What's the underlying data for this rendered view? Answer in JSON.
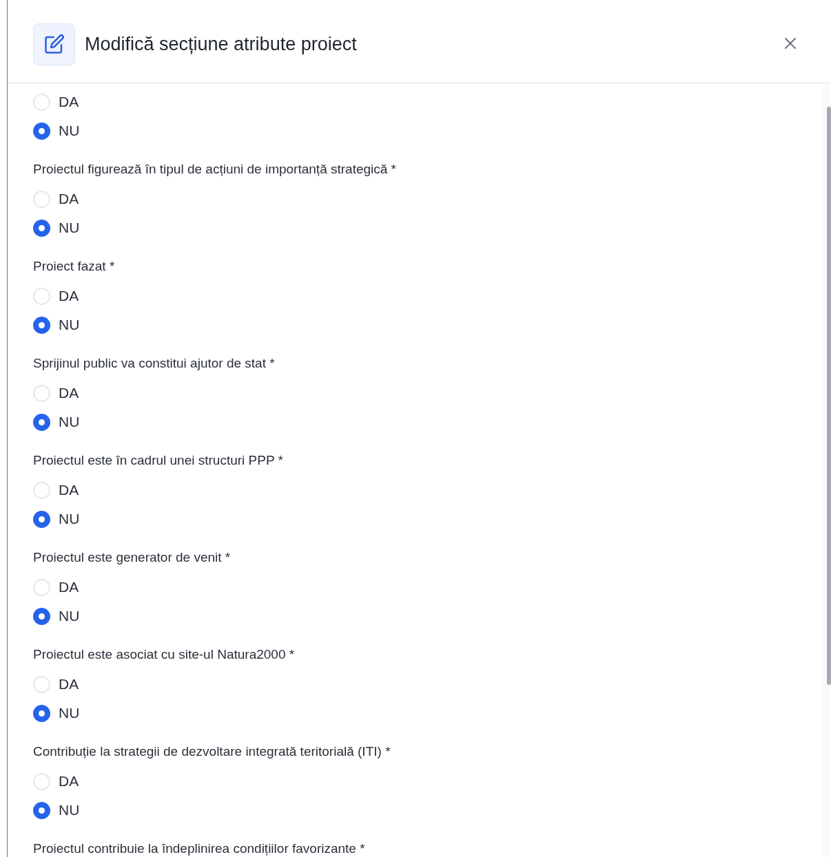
{
  "dialog": {
    "title": "Modifică secțiune atribute proiect"
  },
  "questions": [
    {
      "options": [
        {
          "label": "DA",
          "selected": false
        },
        {
          "label": "NU",
          "selected": true
        }
      ]
    },
    {
      "label": "Proiectul figurează în tipul de acțiuni de importanță strategică *",
      "options": [
        {
          "label": "DA",
          "selected": false
        },
        {
          "label": "NU",
          "selected": true
        }
      ]
    },
    {
      "label": "Proiect fazat *",
      "options": [
        {
          "label": "DA",
          "selected": false
        },
        {
          "label": "NU",
          "selected": true
        }
      ]
    },
    {
      "label": "Sprijinul public va constitui ajutor de stat *",
      "options": [
        {
          "label": "DA",
          "selected": false
        },
        {
          "label": "NU",
          "selected": true
        }
      ]
    },
    {
      "label": "Proiectul este în cadrul unei structuri PPP *",
      "options": [
        {
          "label": "DA",
          "selected": false
        },
        {
          "label": "NU",
          "selected": true
        }
      ]
    },
    {
      "label": "Proiectul este generator de venit *",
      "options": [
        {
          "label": "DA",
          "selected": false
        },
        {
          "label": "NU",
          "selected": true
        }
      ]
    },
    {
      "label": "Proiectul este asociat cu site-ul Natura2000 *",
      "options": [
        {
          "label": "DA",
          "selected": false
        },
        {
          "label": "NU",
          "selected": true
        }
      ]
    },
    {
      "label": "Contribuție la strategii de dezvoltare integrată teritorială (ITI) *",
      "options": [
        {
          "label": "DA",
          "selected": false
        },
        {
          "label": "NU",
          "selected": true
        }
      ]
    },
    {
      "label": "Proiectul contribuie la îndeplinirea condițiilor favorizante *"
    }
  ]
}
